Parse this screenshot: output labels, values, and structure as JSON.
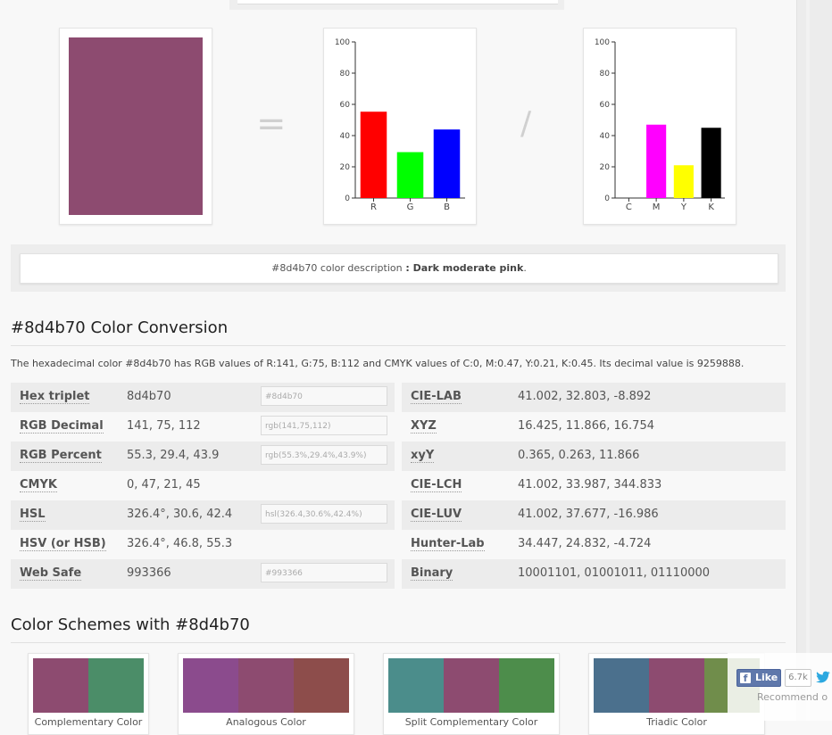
{
  "color": {
    "hex": "#8d4b70",
    "swatch_color": "#8d4b70"
  },
  "signs": {
    "equals": "=",
    "slash": "/"
  },
  "rgb_chart": {
    "type": "bar",
    "categories": [
      "R",
      "G",
      "B"
    ],
    "values": [
      55.3,
      29.4,
      43.9
    ],
    "colors": [
      "#ff0000",
      "#00ff00",
      "#0000ff"
    ],
    "ylim": [
      0,
      100
    ],
    "yticks": [
      "0",
      "20",
      "40",
      "60",
      "80",
      "100"
    ]
  },
  "cmyk_chart": {
    "type": "bar",
    "categories": [
      "C",
      "M",
      "Y",
      "K"
    ],
    "values": [
      0,
      47,
      21,
      45
    ],
    "colors": [
      "#00ffff",
      "#ff00ff",
      "#ffff00",
      "#000000"
    ],
    "ylim": [
      0,
      100
    ],
    "yticks": [
      "0",
      "20",
      "40",
      "60",
      "80",
      "100"
    ]
  },
  "chart_data": [
    {
      "type": "bar",
      "categories": [
        "R",
        "G",
        "B"
      ],
      "values": [
        55.3,
        29.4,
        43.9
      ],
      "ylim": [
        0,
        100
      ]
    },
    {
      "type": "bar",
      "categories": [
        "C",
        "M",
        "Y",
        "K"
      ],
      "values": [
        0,
        47,
        21,
        45
      ],
      "ylim": [
        0,
        100
      ]
    }
  ],
  "description": {
    "prefix": "#8d4b70 color description",
    "separator": " : ",
    "value": "Dark moderate pink",
    "period": "."
  },
  "conversion": {
    "title": "#8d4b70 Color Conversion",
    "intro": "The hexadecimal color #8d4b70 has RGB values of R:141, G:75, B:112 and CMYK values of C:0, M:0.47, Y:0.21, K:0.45. Its decimal value is 9259888.",
    "left_rows": [
      {
        "label": "Hex triplet",
        "value": "8d4b70",
        "input": "#8d4b70"
      },
      {
        "label": "RGB Decimal",
        "value": "141, 75, 112",
        "input": "rgb(141,75,112)"
      },
      {
        "label": "RGB Percent",
        "value": "55.3, 29.4, 43.9",
        "input": "rgb(55.3%,29.4%,43.9%)"
      },
      {
        "label": "CMYK",
        "value": "0, 47, 21, 45",
        "input": ""
      },
      {
        "label": "HSL",
        "value": "326.4°, 30.6, 42.4",
        "input": "hsl(326.4,30.6%,42.4%)"
      },
      {
        "label": "HSV (or HSB)",
        "value": "326.4°, 46.8, 55.3",
        "input": ""
      },
      {
        "label": "Web Safe",
        "value": "993366",
        "input": "#993366"
      }
    ],
    "right_rows": [
      {
        "label": "CIE-LAB",
        "value": "41.002, 32.803, -8.892"
      },
      {
        "label": "XYZ",
        "value": "16.425, 11.866, 16.754"
      },
      {
        "label": "xyY",
        "value": "0.365, 0.263, 11.866"
      },
      {
        "label": "CIE-LCH",
        "value": "41.002, 33.987, 344.833"
      },
      {
        "label": "CIE-LUV",
        "value": "41.002, 37.677, -16.986"
      },
      {
        "label": "Hunter-Lab",
        "value": "34.447, 24.832, -4.724"
      },
      {
        "label": "Binary",
        "value": "10001101, 01001011, 01110000"
      }
    ]
  },
  "schemes": {
    "title": "Color Schemes with #8d4b70",
    "cards": [
      {
        "label": "Complementary Color",
        "colors": [
          "#8d4b70",
          "#4b8d68"
        ]
      },
      {
        "label": "Analogous Color",
        "colors": [
          "#8b4b8d",
          "#8d4b70",
          "#8d4d4b"
        ]
      },
      {
        "label": "Split Complementary Color",
        "colors": [
          "#4b8d8b",
          "#8d4b70",
          "#4d8d4b"
        ]
      },
      {
        "label": "Triadic Color",
        "colors": [
          "#4b708d",
          "#8d4b70",
          "#708d4b"
        ]
      }
    ]
  },
  "social": {
    "like_label": "Like",
    "like_count": "6.7k",
    "recommend_text": "Recommend o"
  }
}
